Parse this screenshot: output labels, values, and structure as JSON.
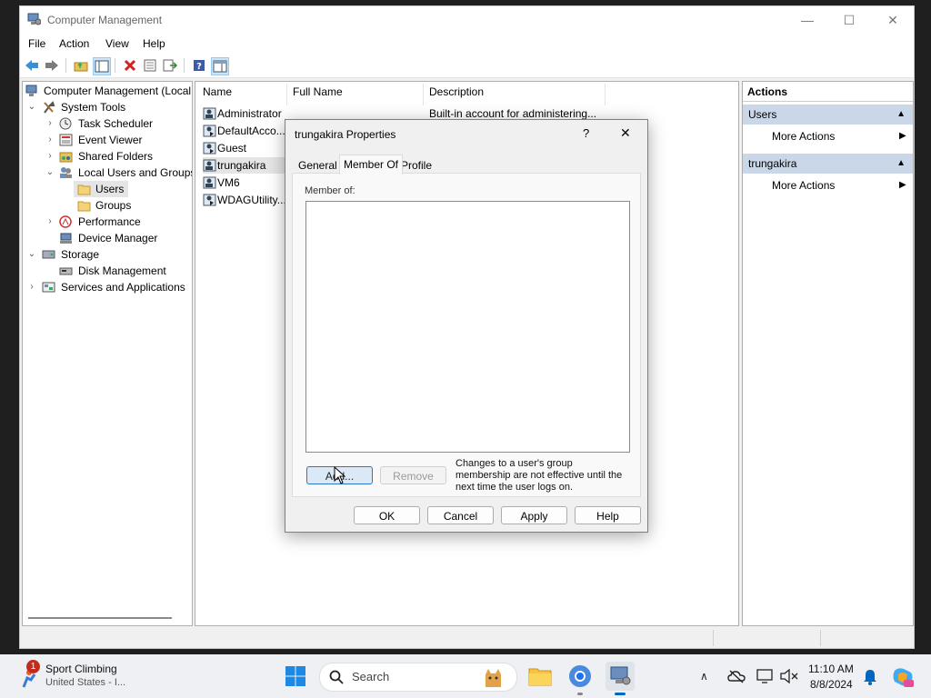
{
  "window": {
    "title": "Computer Management",
    "controls": {
      "minimize": "—",
      "maximize": "☐",
      "close": "✕"
    }
  },
  "menu": [
    "File",
    "Action",
    "View",
    "Help"
  ],
  "tree": {
    "root": "Computer Management (Local",
    "system_tools": "System Tools",
    "task_scheduler": "Task Scheduler",
    "event_viewer": "Event Viewer",
    "shared_folders": "Shared Folders",
    "local_users_groups": "Local Users and Groups",
    "users": "Users",
    "groups": "Groups",
    "performance": "Performance",
    "device_manager": "Device Manager",
    "storage": "Storage",
    "disk_management": "Disk Management",
    "services_apps": "Services and Applications"
  },
  "list": {
    "columns": [
      "Name",
      "Full Name",
      "Description"
    ],
    "rows": [
      {
        "name": "Administrator",
        "description": "Built-in account for administering..."
      },
      {
        "name": "DefaultAcco..."
      },
      {
        "name": "Guest"
      },
      {
        "name": "trungakira"
      },
      {
        "name": "VM6"
      },
      {
        "name": "WDAGUtility..."
      }
    ]
  },
  "actions": {
    "header": "Actions",
    "section1": "Users",
    "item1": "More Actions",
    "section2": "trungakira",
    "item2": "More Actions"
  },
  "dialog": {
    "title": "trungakira Properties",
    "help_glyph": "?",
    "close_glyph": "✕",
    "tabs": [
      "General",
      "Member Of",
      "Profile"
    ],
    "member_of_label": "Member of:",
    "add_button": "Add...",
    "remove_button": "Remove",
    "note": "Changes to a user's group membership are not effective until the next time the user logs on.",
    "ok": "OK",
    "cancel": "Cancel",
    "apply": "Apply",
    "help": "Help"
  },
  "taskbar": {
    "weather_title": "Sport Climbing",
    "weather_sub": "United States - I...",
    "notification_count": "1",
    "search_placeholder": "Search",
    "time": "11:10 AM",
    "date": "8/8/2024"
  },
  "colors": {
    "selection": "#cce4f7",
    "section_header": "#c9d7e8",
    "accent": "#0067c0"
  }
}
